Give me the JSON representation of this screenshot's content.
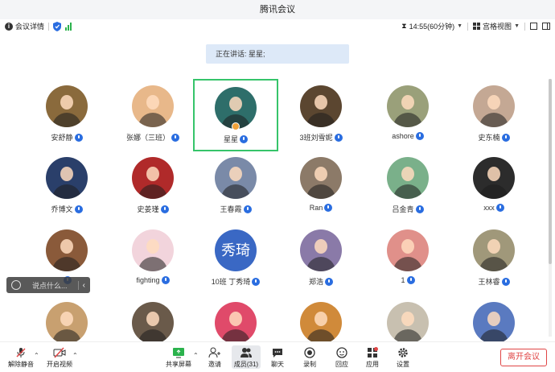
{
  "window": {
    "title": "腾讯会议"
  },
  "toolbar": {
    "meeting_info": "会议详情",
    "timer": "14:55(60分钟)",
    "view": "宫格视图"
  },
  "speaking": {
    "label": "正在讲话: 星星;"
  },
  "participants": [
    {
      "name": "安舒静",
      "avatar_color": "#8a6a3c"
    },
    {
      "name": "张娜（三班）",
      "avatar_color": "#e8b88a"
    },
    {
      "name": "星星",
      "avatar_color": "#2e6e6a"
    },
    {
      "name": "3班刘雪妮",
      "avatar_color": "#5b4630"
    },
    {
      "name": "ashore",
      "avatar_color": "#9aa07a"
    },
    {
      "name": "史东楠",
      "avatar_color": "#c4a894"
    },
    {
      "name": "乔博文",
      "avatar_color": "#2a3f6a"
    },
    {
      "name": "史姜瑾",
      "avatar_color": "#b02a2a"
    },
    {
      "name": "王春霞",
      "avatar_color": "#7a8aa8"
    },
    {
      "name": "Ran",
      "avatar_color": "#8c7a68"
    },
    {
      "name": "吕金青",
      "avatar_color": "#7ab08a"
    },
    {
      "name": "xxx",
      "avatar_color": "#2c2c2c"
    },
    {
      "name": "",
      "avatar_color": "#8a5a3a"
    },
    {
      "name": "fighting",
      "avatar_color": "#f2d4dc"
    },
    {
      "name": "10班 丁秀琦",
      "avatar_color": "#3a68c4",
      "text_avatar": "秀琦"
    },
    {
      "name": "郑浩",
      "avatar_color": "#8a7aa8"
    },
    {
      "name": "1",
      "avatar_color": "#e0908a"
    },
    {
      "name": "王林睿",
      "avatar_color": "#a0987a"
    },
    {
      "name": "",
      "avatar_color": "#c8a070"
    },
    {
      "name": "",
      "avatar_color": "#6a5a4a"
    },
    {
      "name": "",
      "avatar_color": "#e04a6a"
    },
    {
      "name": "",
      "avatar_color": "#d08a3a"
    },
    {
      "name": "",
      "avatar_color": "#c8c0b0"
    },
    {
      "name": "",
      "avatar_color": "#5a7ac0"
    }
  ],
  "chat": {
    "placeholder": "说点什么..."
  },
  "bottom": {
    "unmute": "解除静音",
    "video": "开启视频",
    "share": "共享屏幕",
    "invite": "邀请",
    "members": "成员(31)",
    "chat": "聊天",
    "record": "录制",
    "reaction": "回应",
    "apps": "应用",
    "settings": "设置",
    "leave": "离开会议"
  },
  "colors": {
    "accent": "#2a6de0",
    "active_border": "#36c46a",
    "leave": "#e04545"
  }
}
